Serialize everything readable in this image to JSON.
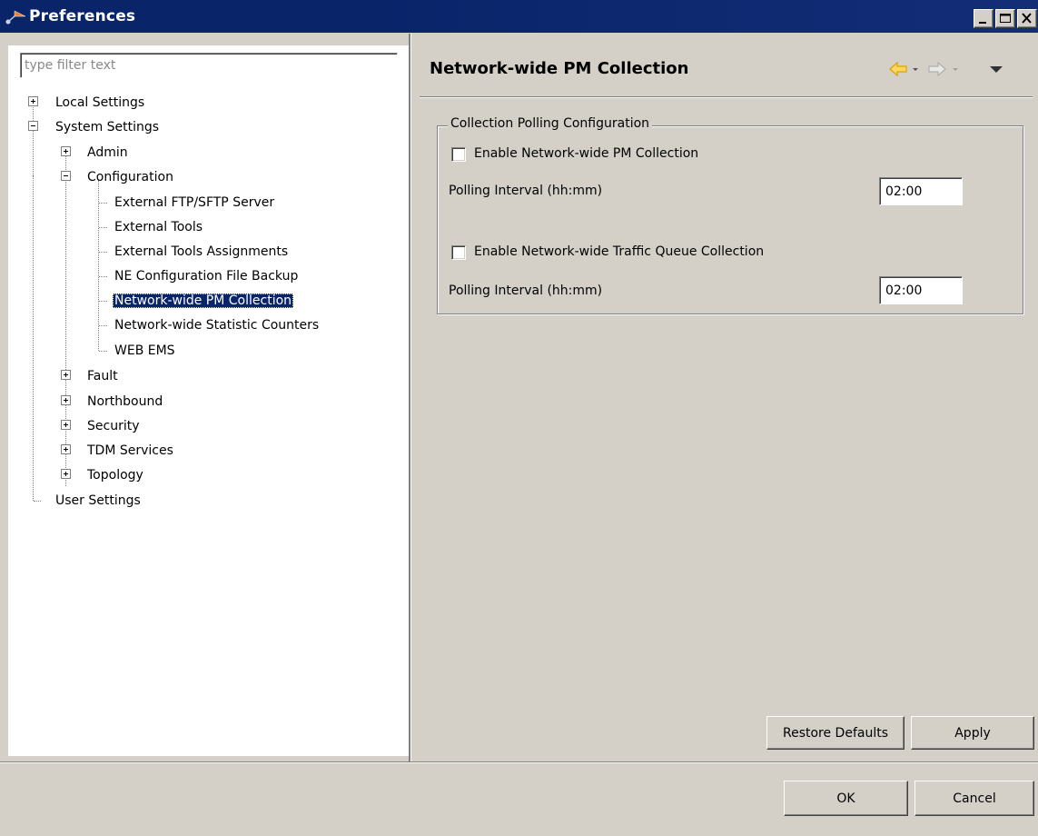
{
  "window": {
    "title": "Preferences"
  },
  "filter": {
    "placeholder": "type filter text"
  },
  "tree": {
    "local_settings": "Local Settings",
    "system_settings": "System Settings",
    "admin": "Admin",
    "configuration": "Configuration",
    "ftp": "External FTP/SFTP Server",
    "tools": "External Tools",
    "tools_assign": "External Tools Assignments",
    "ne_backup": "NE Configuration File Backup",
    "pm_collection": "Network-wide PM Collection",
    "stat_counters": "Network-wide Statistic Counters",
    "web_ems": "WEB EMS",
    "fault": "Fault",
    "northbound": "Northbound",
    "security": "Security",
    "tdm": "TDM Services",
    "topology": "Topology",
    "user_settings": "User Settings"
  },
  "page": {
    "title": "Network-wide PM Collection",
    "group_title": "Collection Polling Configuration",
    "enable_pm_label": "Enable Network-wide PM Collection",
    "enable_pm_checked": false,
    "polling1_label": "Polling Interval (hh:mm)",
    "polling1_value": "02:00",
    "enable_queue_label": "Enable Network-wide Traffic Queue Collection",
    "enable_queue_checked": false,
    "polling2_label": "Polling Interval (hh:mm)",
    "polling2_value": "02:00",
    "restore_defaults": "Restore Defaults",
    "apply": "Apply"
  },
  "footer": {
    "ok": "OK",
    "cancel": "Cancel"
  },
  "colors": {
    "title_bar": "#0a246a",
    "selection": "#0a246a",
    "dialog_bg": "#d4d0c8",
    "back_arrow": "#f0b000"
  }
}
